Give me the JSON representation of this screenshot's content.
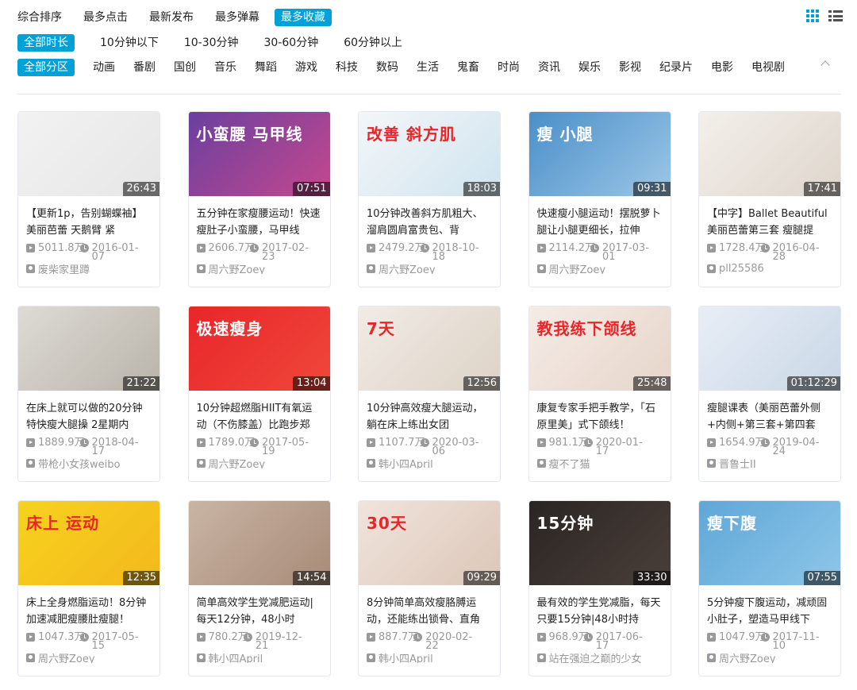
{
  "sort_options": [
    {
      "label": "综合排序",
      "active": false
    },
    {
      "label": "最多点击",
      "active": false
    },
    {
      "label": "最新发布",
      "active": false
    },
    {
      "label": "最多弹幕",
      "active": false
    },
    {
      "label": "最多收藏",
      "active": true
    }
  ],
  "duration_options": [
    {
      "label": "全部时长",
      "active": true
    },
    {
      "label": "10分钟以下",
      "active": false
    },
    {
      "label": "10-30分钟",
      "active": false
    },
    {
      "label": "30-60分钟",
      "active": false
    },
    {
      "label": "60分钟以上",
      "active": false
    }
  ],
  "category_options": [
    {
      "label": "全部分区",
      "active": true
    },
    {
      "label": "动画",
      "active": false
    },
    {
      "label": "番剧",
      "active": false
    },
    {
      "label": "国创",
      "active": false
    },
    {
      "label": "音乐",
      "active": false
    },
    {
      "label": "舞蹈",
      "active": false
    },
    {
      "label": "游戏",
      "active": false
    },
    {
      "label": "科技",
      "active": false
    },
    {
      "label": "数码",
      "active": false
    },
    {
      "label": "生活",
      "active": false
    },
    {
      "label": "鬼畜",
      "active": false
    },
    {
      "label": "时尚",
      "active": false
    },
    {
      "label": "资讯",
      "active": false
    },
    {
      "label": "娱乐",
      "active": false
    },
    {
      "label": "影视",
      "active": false
    },
    {
      "label": "纪录片",
      "active": false
    },
    {
      "label": "电影",
      "active": false
    },
    {
      "label": "电视剧",
      "active": false
    }
  ],
  "colors": {
    "accent": "#00a1d6",
    "meta": "#999999"
  },
  "icons": {
    "grid_view": "grid-view-icon",
    "list_view": "list-view-icon",
    "collapse": "chevron-up-icon"
  },
  "videos": [
    {
      "title": "【更新1p，告别蝴蝶袖】美丽芭蕾 天鹅臂 紧",
      "views": "5011.8万",
      "date": "2016-01-07",
      "author": "废柴家里蹲",
      "duration": "26:43",
      "thumb_colors": [
        "#f2f2f2",
        "#e6e6e6"
      ],
      "thumb_text": ""
    },
    {
      "title": "五分钟在家瘦腰运动！快速瘦肚子小蛮腰，马甲线",
      "views": "2606.7万",
      "date": "2017-02-23",
      "author": "周六野Zoey",
      "duration": "07:51",
      "thumb_colors": [
        "#6b3fa0",
        "#c4488d"
      ],
      "thumb_text": "小蛮腰 马甲线"
    },
    {
      "title": "10分钟改善斜方肌粗大、溜肩圆肩富贵包、背",
      "views": "2479.2万",
      "date": "2018-10-18",
      "author": "周六野Zoey",
      "duration": "18:03",
      "thumb_colors": [
        "#f4f6f8",
        "#cfe4ef"
      ],
      "thumb_text": "改善 斜方肌"
    },
    {
      "title": "快速瘦小腿运动！摆脱萝卜腿让小腿更细长，拉伸",
      "views": "2114.2万",
      "date": "2017-03-01",
      "author": "周六野Zoey",
      "duration": "09:31",
      "thumb_colors": [
        "#4a8fc9",
        "#9cc7e6"
      ],
      "thumb_text": "瘦 小腿"
    },
    {
      "title": "【中字】Ballet Beautiful 美丽芭蕾第三套 瘦腿提",
      "views": "1728.4万",
      "date": "2016-04-28",
      "author": "pll25586",
      "duration": "17:41",
      "thumb_colors": [
        "#f3efea",
        "#ded6cc"
      ],
      "thumb_text": ""
    },
    {
      "title": "在床上就可以做的20分钟特快瘦大腿操 2星期内",
      "views": "1889.9万",
      "date": "2018-04-17",
      "author": "带枪小女孩weibo",
      "duration": "21:22",
      "thumb_colors": [
        "#dedbd5",
        "#b9b4aa"
      ],
      "thumb_text": ""
    },
    {
      "title": "10分钟超燃脂HIIT有氧运动（不伤膝盖）比跑步郑",
      "views": "1789.0万",
      "date": "2017-05-19",
      "author": "周六野Zoey",
      "duration": "13:04",
      "thumb_colors": [
        "#e8262a",
        "#f0473a"
      ],
      "thumb_text": "极速瘦身"
    },
    {
      "title": "10分钟高效瘦大腿运动，躺在床上练出女团",
      "views": "1107.7万",
      "date": "2020-03-06",
      "author": "韩小四April",
      "duration": "12:56",
      "thumb_colors": [
        "#f1ece6",
        "#ddd2c6"
      ],
      "thumb_text": "7天"
    },
    {
      "title": "康复专家手把手教学，「石原里美」式下颌线！",
      "views": "981.1万",
      "date": "2020-01-17",
      "author": "瘦不了猫",
      "duration": "25:48",
      "thumb_colors": [
        "#f5ece6",
        "#e6d5ca"
      ],
      "thumb_text": "教我练下颌线"
    },
    {
      "title": "瘦腿课表（美丽芭蕾外侧+内侧+第三套+第四套",
      "views": "1654.9万",
      "date": "2019-04-24",
      "author": "晋鲁士II",
      "duration": "01:12:29",
      "thumb_colors": [
        "#e8eef6",
        "#c9d7e6"
      ],
      "thumb_text": ""
    },
    {
      "title": "床上全身燃脂运动！8分钟加速减肥瘦腰肚瘦腿！",
      "views": "1047.3万",
      "date": "2017-05-15",
      "author": "周六野Zoey",
      "duration": "12:35",
      "thumb_colors": [
        "#f7d21f",
        "#f3b81c"
      ],
      "thumb_text": "床上 运动"
    },
    {
      "title": "简单高效学生党减肥运动|每天12分钟，48小时",
      "views": "780.2万",
      "date": "2019-12-21",
      "author": "韩小四April",
      "duration": "14:54",
      "thumb_colors": [
        "#c9b4a4",
        "#a88b78"
      ],
      "thumb_text": ""
    },
    {
      "title": "8分钟简单高效瘦胳膊运动，还能练出锁骨、直角",
      "views": "887.7万",
      "date": "2020-02-22",
      "author": "韩小四April",
      "duration": "09:29",
      "thumb_colors": [
        "#f0e4dc",
        "#dcc6b8"
      ],
      "thumb_text": "30天"
    },
    {
      "title": "最有效的学生党减脂，每天只要15分钟|48小时持",
      "views": "968.9万",
      "date": "2017-06-17",
      "author": "站在强迫之巅的少女",
      "duration": "33:30",
      "thumb_colors": [
        "#2a2523",
        "#4a3f3a"
      ],
      "thumb_text": "15分钟"
    },
    {
      "title": "5分钟瘦下腹运动，减顽固小肚子，塑造马甲线下",
      "views": "1047.9万",
      "date": "2017-11-10",
      "author": "周六野Zoey",
      "duration": "07:55",
      "thumb_colors": [
        "#5fa7d8",
        "#8ec6e8"
      ],
      "thumb_text": "瘦下腹"
    }
  ]
}
